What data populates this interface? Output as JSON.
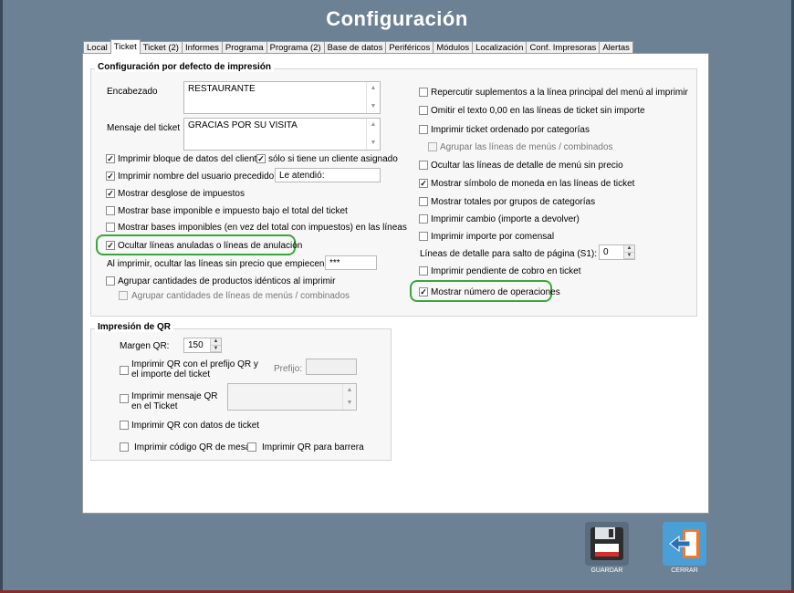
{
  "window": {
    "title": "Configuración"
  },
  "tabs": [
    "Local",
    "Ticket",
    "Ticket (2)",
    "Informes",
    "Programa",
    "Programa (2)",
    "Base de datos",
    "Periféricos",
    "Módulos",
    "Localización",
    "Conf. Impresoras",
    "Alertas"
  ],
  "active_tab": "Ticket",
  "print_defaults": {
    "legend": "Configuración por defecto de impresión",
    "header_label": "Encabezado",
    "header_value": "RESTAURANTE",
    "message_label": "Mensaje del ticket",
    "message_value": "GRACIAS POR SU VISITA",
    "print_client_block": "Imprimir bloque de datos del cliente",
    "only_if_client": "sólo si tiene un cliente asignado",
    "print_username": "Imprimir nombre del usuario precedido de:",
    "username_prefix": "Le atendió:",
    "tax_breakdown": "Mostrar desglose de impuestos",
    "base_below_total": "Mostrar base imponible e impuesto bajo el total del ticket",
    "bases_in_lines": "Mostrar bases imponibles (en vez del total con impuestos) en las líneas",
    "hide_cancelled": "Ocultar líneas anuladas o líneas de anulación",
    "hide_zero_prefix": "Al imprimir, ocultar las líneas sin precio que empiecen por:",
    "hide_zero_prefix_value": "***",
    "group_identical": "Agrupar cantidades de productos idénticos al imprimir",
    "group_menu_lines": "Agrupar cantidades de líneas de menús / combinados",
    "right_col": {
      "supplements": "Repercutir suplementos a la línea principal del menú al imprimir",
      "omit_zero": "Omitir el texto 0,00 en las líneas de ticket sin importe",
      "by_category": "Imprimir ticket ordenado por categorías",
      "group_menu": "Agrupar las líneas de menús / combinados",
      "hide_menu_detail": "Ocultar las líneas de detalle de menú sin precio",
      "currency_symbol": "Mostrar símbolo de moneda en las líneas de ticket",
      "category_totals": "Mostrar totales por grupos de categorías",
      "print_change": "Imprimir cambio (importe a devolver)",
      "per_diner": "Imprimir importe por comensal",
      "page_break_label": "Líneas de detalle para salto de página (S1):",
      "page_break_value": "0",
      "pending_payment": "Imprimir pendiente de cobro en ticket",
      "operation_number": "Mostrar número de operaciones"
    }
  },
  "qr": {
    "legend": "Impresión de QR",
    "margin_label": "Margen QR:",
    "margin_value": "150",
    "prefix_amount": "Imprimir QR con el prefijo QR y el importe del ticket",
    "prefix_label": "Prefijo:",
    "message_qr": "Imprimir mensaje QR en el Ticket",
    "ticket_data": "Imprimir QR con datos de ticket",
    "table_code": "Imprimir código QR de mesa",
    "barrier": "Imprimir QR para barrera"
  },
  "buttons": {
    "save": "GUARDAR",
    "close": "CERRAR"
  },
  "colors": {
    "background": "#6d8195",
    "highlight": "#3aa63a"
  }
}
